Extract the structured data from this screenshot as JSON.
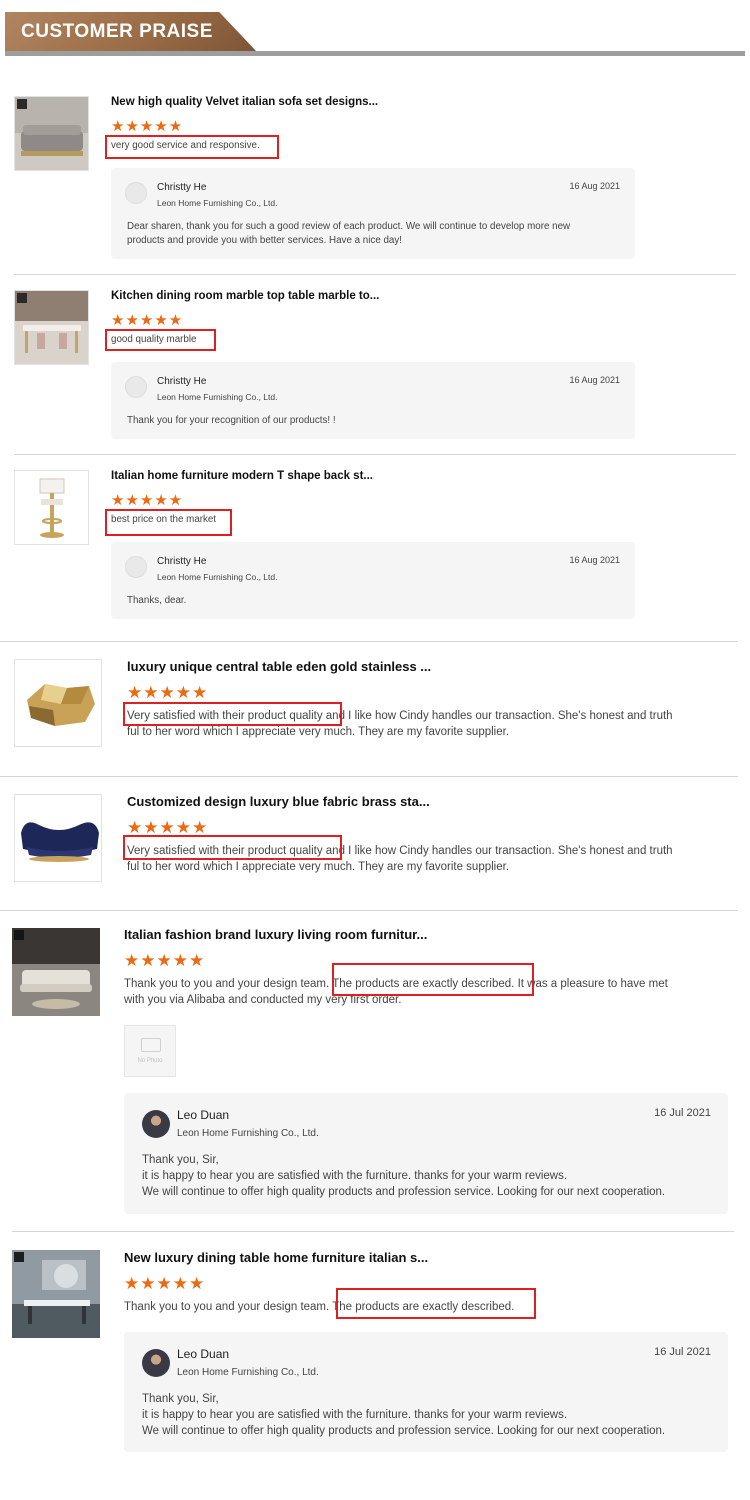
{
  "header": {
    "title": "CUSTOMER PRAISE"
  },
  "reviews": [
    {
      "title": "New high quality Velvet italian sofa set designs...",
      "stars": "★★★★★",
      "comment": "very good service and responsive.",
      "reply": {
        "name": "Christty He",
        "company": "Leon Home Furnishing Co., Ltd.",
        "date": "16 Aug 2021",
        "lines": [
          "Dear sharen, thank you for such a good review of each product. We will continue to develop more new",
          "products and provide you with better services. Have a nice day!"
        ]
      }
    },
    {
      "title": "Kitchen dining room marble top table marble to...",
      "stars": "★★★★★",
      "comment": "good quality marble",
      "reply": {
        "name": "Christty He",
        "company": "Leon Home Furnishing Co., Ltd.",
        "date": "16 Aug 2021",
        "lines": [
          "Thank you for your recognition of our products! !"
        ]
      }
    },
    {
      "title": "Italian home furniture modern T shape back st...",
      "stars": "★★★★★",
      "comment": "best price on the market",
      "reply": {
        "name": "Christty He",
        "company": "Leon Home Furnishing Co., Ltd.",
        "date": "16 Aug 2021",
        "lines": [
          "Thanks, dear."
        ]
      }
    },
    {
      "title": "luxury unique central table eden gold stainless ...",
      "stars": "★★★★★",
      "comment_lines": [
        "Very satisfied with their product quality and I like how Cindy handles our transaction. She's honest and truth",
        "ful to her word which I appreciate very much. They are my favorite supplier."
      ]
    },
    {
      "title": "Customized design luxury blue fabric brass sta...",
      "stars": "★★★★★",
      "comment_lines": [
        "Very satisfied with their product quality and I like how Cindy handles our transaction. She's honest and truth",
        "ful to her word which I appreciate very much. They are my favorite supplier."
      ]
    },
    {
      "title": "Italian fashion brand luxury living room furnitur...",
      "stars": "★★★★★",
      "comment_lines": [
        "Thank you to you and your design team. The products are exactly described. It was a pleasure to have met",
        "with you via Alibaba and conducted my very first order."
      ],
      "photo_placeholder": "No Photo",
      "reply": {
        "name": "Leo Duan",
        "company": "Leon Home Furnishing Co., Ltd.",
        "date": "16 Jul 2021",
        "lines": [
          "Thank you, Sir,",
          "it is happy to hear you are satisfied with the furniture. thanks for your warm reviews.",
          "We will continue to offer high quality products and profession service. Looking for our next cooperation."
        ]
      }
    },
    {
      "title": "New luxury dining table home furniture italian s...",
      "stars": "★★★★★",
      "comment_lines": [
        "Thank you to you and your design team. The products are exactly described."
      ],
      "reply": {
        "name": "Leo Duan",
        "company": "Leon Home Furnishing Co., Ltd.",
        "date": "16 Jul 2021",
        "lines": [
          "Thank you, Sir,",
          "it is happy to hear you are satisfied with the furniture. thanks for your warm reviews.",
          "We will continue to offer high quality products and profession service. Looking for our next cooperation."
        ]
      }
    }
  ],
  "colors": {
    "star": "#ec6a12",
    "highlight": "#e02020",
    "banner": "#9a6c47",
    "reply_bg": "#f5f5f6"
  }
}
